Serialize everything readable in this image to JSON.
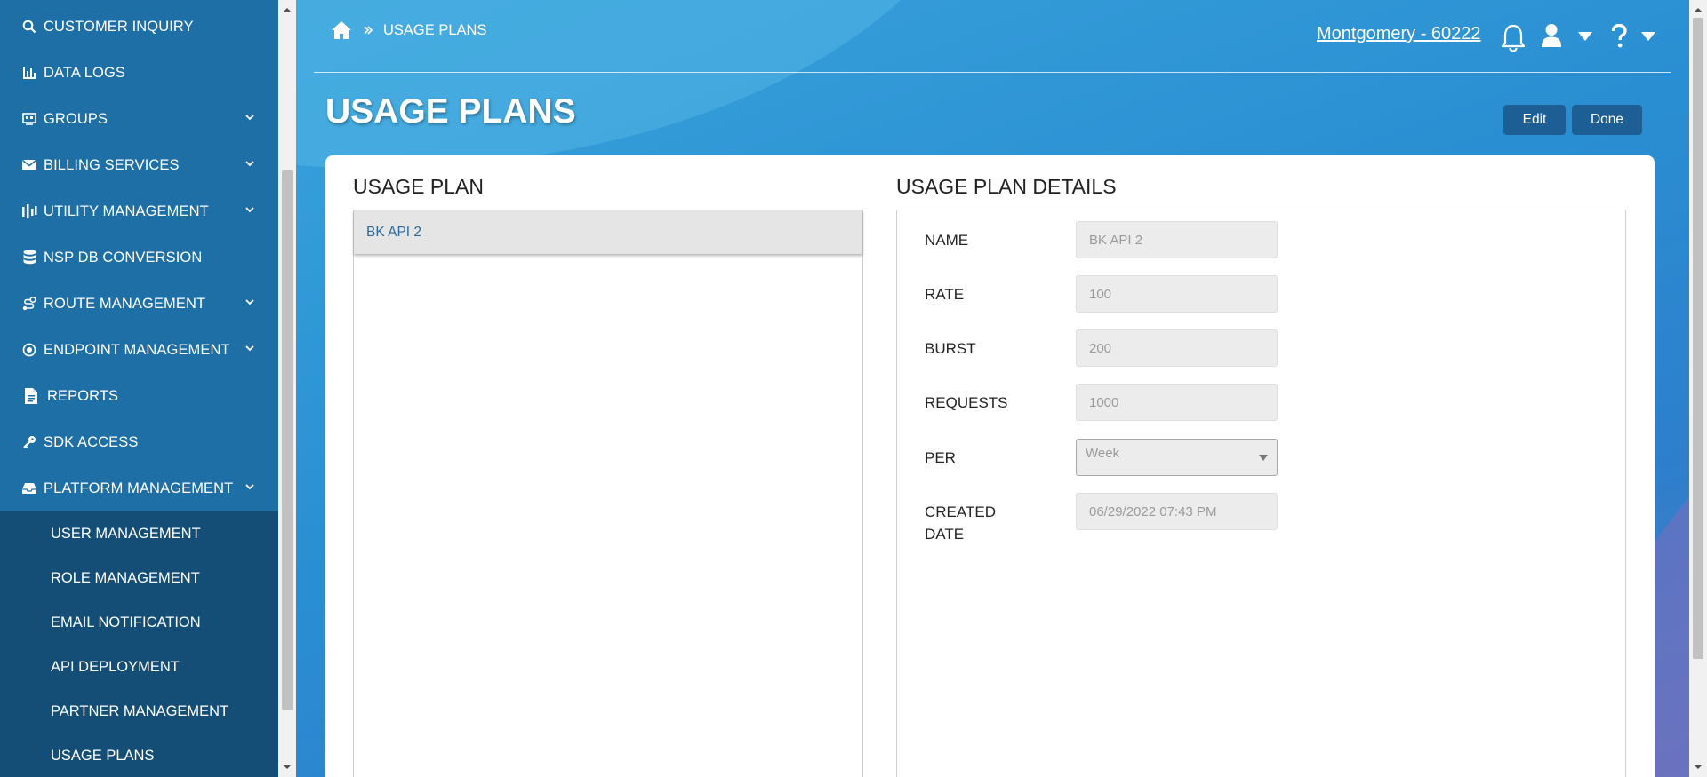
{
  "sidebar": {
    "items": [
      {
        "label": "CUSTOMER INQUIRY",
        "icon": "search-icon"
      },
      {
        "label": "DATA LOGS",
        "icon": "bar-chart-icon"
      },
      {
        "label": "GROUPS",
        "icon": "groups-icon"
      },
      {
        "label": "BILLING SERVICES",
        "icon": "envelope-icon"
      },
      {
        "label": "UTILITY MANAGEMENT",
        "icon": "sliders-icon"
      },
      {
        "label": "NSP DB CONVERSION",
        "icon": "database-icon"
      },
      {
        "label": "ROUTE MANAGEMENT",
        "icon": "route-icon"
      },
      {
        "label": "ENDPOINT MANAGEMENT",
        "icon": "dot-circle-icon"
      },
      {
        "label": "REPORTS",
        "icon": "document-icon"
      },
      {
        "label": "SDK ACCESS",
        "icon": "key-icon"
      },
      {
        "label": "PLATFORM MANAGEMENT",
        "icon": "inbox-icon"
      }
    ],
    "submenu": [
      {
        "label": "USER MANAGEMENT"
      },
      {
        "label": "ROLE MANAGEMENT"
      },
      {
        "label": "EMAIL NOTIFICATION"
      },
      {
        "label": "API DEPLOYMENT"
      },
      {
        "label": "PARTNER MANAGEMENT"
      },
      {
        "label": "USAGE PLANS"
      }
    ]
  },
  "header": {
    "breadcrumb_current": "USAGE PLANS",
    "account": "Montgomery - 60222",
    "icons": [
      "home-icon",
      "bell-icon",
      "user-icon",
      "help-icon"
    ]
  },
  "page": {
    "title": "USAGE PLANS",
    "edit_label": "Edit",
    "done_label": "Done"
  },
  "usage_plan": {
    "title": "USAGE PLAN",
    "items": [
      "BK API 2"
    ]
  },
  "details": {
    "title": "USAGE PLAN DETAILS",
    "name_label": "NAME",
    "name_value": "BK API 2",
    "rate_label": "RATE",
    "rate_value": "100",
    "burst_label": "BURST",
    "burst_value": "200",
    "requests_label": "REQUESTS",
    "requests_value": "1000",
    "per_label": "PER",
    "per_value": "Week",
    "created_label_line1": "CREATED",
    "created_label_line2": "DATE",
    "created_value": "06/29/2022 07:43 PM"
  },
  "colors": {
    "sidebar": "#1e6fa5",
    "submenu": "#144e76",
    "button": "#1d5f95",
    "link": "#2a6a9f"
  }
}
